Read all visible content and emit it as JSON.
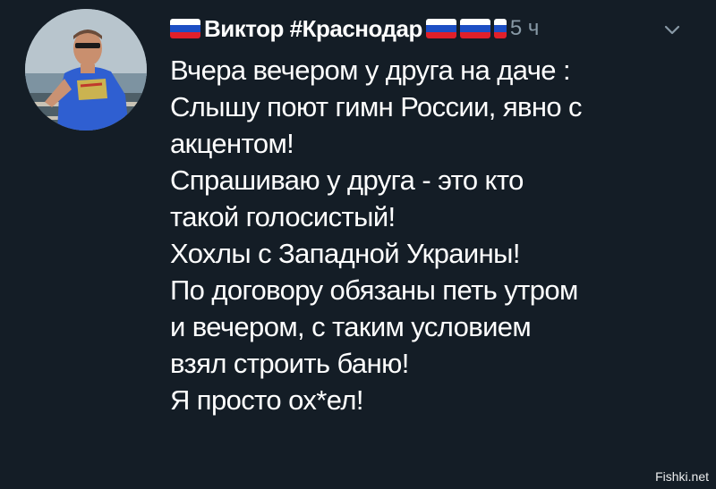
{
  "tweet": {
    "author_name": "Виктор #Краснодар",
    "timestamp": "5 ч",
    "avatar_icon": "user-avatar-photo",
    "menu_icon": "chevron-down-icon",
    "flag_icon": "russian-flag-emoji",
    "lines": [
      "Вчера вечером у друга на даче :",
      "Слышу поют гимн России, явно с",
      "акцентом!",
      "Спрашиваю у друга - это кто",
      "такой голосистый!",
      "Хохлы с Западной Украины!",
      "По договору обязаны петь утром",
      "и вечером, с таким условием",
      "взял строить баню!",
      "Я просто ох*ел!"
    ]
  },
  "watermark": "Fishki.net",
  "colors": {
    "background": "#141d26",
    "text": "#ffffff",
    "muted": "#8899a6"
  }
}
